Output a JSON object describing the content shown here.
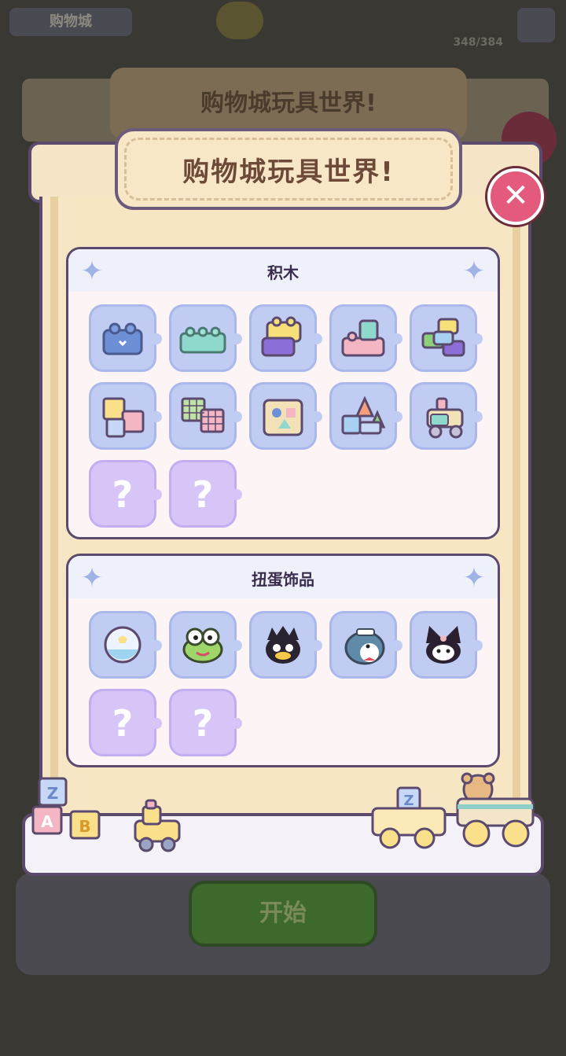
{
  "background": {
    "mall_label": "购物城",
    "score_text": "348/384",
    "ghost_title": "购物城玩具世界!",
    "start_label": "开始"
  },
  "modal": {
    "title": "购物城玩具世界!",
    "close_label": "✕"
  },
  "sections": [
    {
      "title": "积木",
      "items": [
        {
          "icon": "blue-brick-icon",
          "unlocked": true
        },
        {
          "icon": "mint-long-brick-icon",
          "unlocked": true
        },
        {
          "icon": "yellow-purple-brick-icon",
          "unlocked": true
        },
        {
          "icon": "pink-stacked-brick-icon",
          "unlocked": true
        },
        {
          "icon": "colorful-brick-tower-icon",
          "unlocked": true
        },
        {
          "icon": "shape-blocks-icon",
          "unlocked": true
        },
        {
          "icon": "rubiks-cubes-icon",
          "unlocked": true
        },
        {
          "icon": "shape-sorter-icon",
          "unlocked": true
        },
        {
          "icon": "block-castle-icon",
          "unlocked": true
        },
        {
          "icon": "toy-train-icon",
          "unlocked": true
        },
        {
          "icon": "locked-question-icon",
          "unlocked": false,
          "label": "?"
        },
        {
          "icon": "locked-question-icon",
          "unlocked": false,
          "label": "?"
        }
      ]
    },
    {
      "title": "扭蛋饰品",
      "items": [
        {
          "icon": "capsule-ball-icon",
          "unlocked": true
        },
        {
          "icon": "frog-face-icon",
          "unlocked": true
        },
        {
          "icon": "penguin-badtz-icon",
          "unlocked": true
        },
        {
          "icon": "sailor-penguin-icon",
          "unlocked": true
        },
        {
          "icon": "kuromi-icon",
          "unlocked": true
        },
        {
          "icon": "locked-question-icon",
          "unlocked": false,
          "label": "?"
        },
        {
          "icon": "locked-question-icon",
          "unlocked": false,
          "label": "?"
        }
      ]
    }
  ],
  "floor_toys": {
    "block_letters": [
      "Z",
      "A",
      "B"
    ],
    "cart_letter": "Z"
  },
  "colors": {
    "slot_unlocked": "#c1ccf2",
    "slot_locked": "#d6c5f6",
    "close_button": "#e45a7c",
    "outline": "#5c4a6e"
  }
}
